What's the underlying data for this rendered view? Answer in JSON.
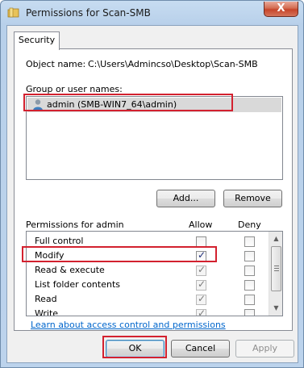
{
  "window": {
    "title": "Permissions for Scan-SMB",
    "close_glyph": "X",
    "icon": "folder-icon"
  },
  "tabs": [
    {
      "label": "Security",
      "selected": true
    }
  ],
  "object": {
    "label": "Object name:",
    "value": "C:\\Users\\Admincso\\Desktop\\Scan-SMB"
  },
  "groups": {
    "label": "Group or user names:",
    "items": [
      {
        "name": "admin (SMB-WIN7_64\\admin)",
        "icon": "user-icon",
        "selected": true
      }
    ]
  },
  "buttons": {
    "add": "Add...",
    "remove": "Remove",
    "ok": "OK",
    "cancel": "Cancel",
    "apply": "Apply"
  },
  "permissions": {
    "header": "Permissions for admin",
    "allow_header": "Allow",
    "deny_header": "Deny",
    "rows": [
      {
        "name": "Full control",
        "allow": false,
        "deny": false,
        "disabled": false
      },
      {
        "name": "Modify",
        "allow": true,
        "deny": false,
        "disabled": false
      },
      {
        "name": "Read & execute",
        "allow": true,
        "deny": false,
        "disabled": true
      },
      {
        "name": "List folder contents",
        "allow": true,
        "deny": false,
        "disabled": true
      },
      {
        "name": "Read",
        "allow": true,
        "deny": false,
        "disabled": true
      },
      {
        "name": "Write",
        "allow": true,
        "deny": false,
        "disabled": true
      }
    ]
  },
  "link": "Learn about access control and permissions",
  "colors": {
    "highlight": "#d3212f",
    "link": "#0066cc",
    "titlebar": "#b9d1ea"
  }
}
